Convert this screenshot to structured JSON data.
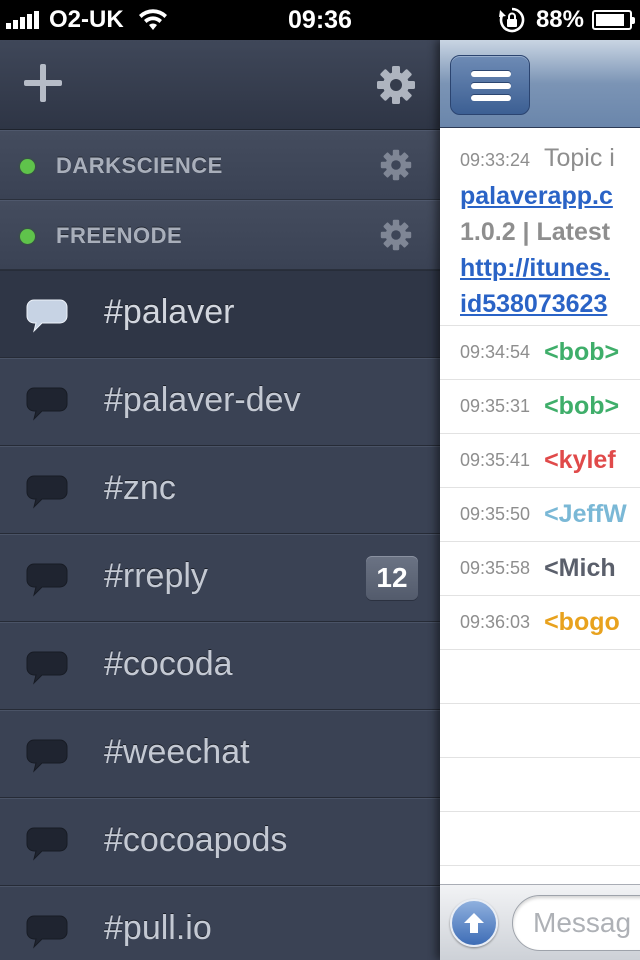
{
  "status_bar": {
    "carrier": "O2-UK",
    "time": "09:36",
    "battery_percent": "88%",
    "battery_level": 0.88,
    "icons": [
      "signal-icon",
      "wifi-icon",
      "rotation-lock-icon",
      "battery-icon"
    ]
  },
  "sidebar": {
    "header_icons": [
      "plus-icon",
      "gear-icon"
    ],
    "networks": [
      {
        "label": "DARKSCIENCE",
        "status_color": "#5fc34b"
      },
      {
        "label": "FREENODE",
        "status_color": "#5fc34b"
      }
    ],
    "channels": [
      {
        "label": "#palaver",
        "selected": true,
        "badge": ""
      },
      {
        "label": "#palaver-dev",
        "selected": false,
        "badge": ""
      },
      {
        "label": "#znc",
        "selected": false,
        "badge": ""
      },
      {
        "label": "#rreply",
        "selected": false,
        "badge": "12"
      },
      {
        "label": "#cocoda",
        "selected": false,
        "badge": ""
      },
      {
        "label": "#weechat",
        "selected": false,
        "badge": ""
      },
      {
        "label": "#cocoapods",
        "selected": false,
        "badge": ""
      },
      {
        "label": "#pull.io",
        "selected": false,
        "badge": ""
      }
    ]
  },
  "main": {
    "nav": {
      "menu_icon": "menu-icon"
    },
    "topic": {
      "time": "09:33:24",
      "text": "Topic i",
      "link1": "palaverapp.c",
      "version": "1.0.2 | Latest",
      "link2": "http://itunes.",
      "link3": "id538073623"
    },
    "messages": [
      {
        "time": "09:34:54",
        "nick": "<bob>",
        "color": "#3fae6a"
      },
      {
        "time": "09:35:31",
        "nick": "<bob>",
        "color": "#3fae6a"
      },
      {
        "time": "09:35:41",
        "nick": "<kylef",
        "color": "#e04a4a"
      },
      {
        "time": "09:35:50",
        "nick": "<JeffW",
        "color": "#7ab8d6"
      },
      {
        "time": "09:35:58",
        "nick": "<Mich",
        "color": "#5a5f6b"
      },
      {
        "time": "09:36:03",
        "nick": "<bogo",
        "color": "#e8a21e"
      }
    ],
    "input": {
      "placeholder": "Messag"
    },
    "colors": {
      "link": "#2a63c6",
      "nav_top": "#c9d5e3",
      "nav_bottom": "#6a86ab"
    }
  }
}
